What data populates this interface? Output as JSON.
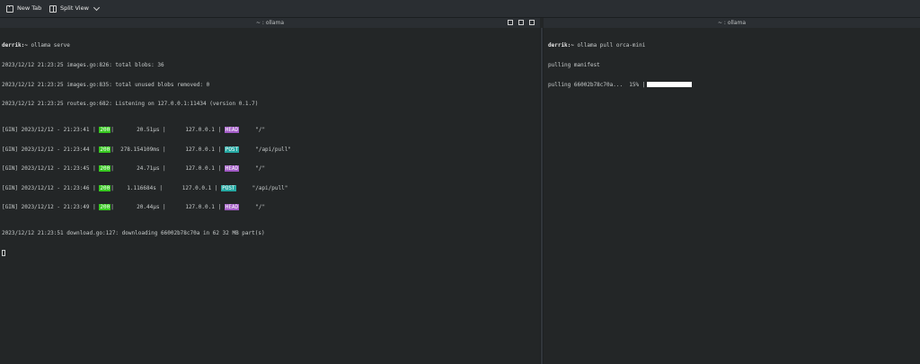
{
  "toolbar": {
    "new_tab_label": "New Tab",
    "split_view_label": "Split View"
  },
  "panes": [
    {
      "title": "~ : ollama",
      "prompt": "derrik:~",
      "command": " ollama serve",
      "log_lines": [
        "2023/12/12 21:23:25 images.go:826: total blobs: 36",
        "2023/12/12 21:23:25 images.go:835: total unused blobs removed: 0",
        "2023/12/12 21:23:25 routes.go:682: Listening on 127.0.0.1:11434 (version 0.1.7)"
      ],
      "gin_rows": [
        {
          "prefix": "[GIN] 2023/12/12 - 21:23:41 |",
          "status": "200",
          "latency": "       20.51µs |",
          "ip": "      127.0.0.1 |",
          "method": "HEAD",
          "path": "     \"/\""
        },
        {
          "prefix": "[GIN] 2023/12/12 - 21:23:44 |",
          "status": "200",
          "latency": "  278.154109ms |",
          "ip": "      127.0.0.1 |",
          "method": "POST",
          "path": "     \"/api/pull\""
        },
        {
          "prefix": "[GIN] 2023/12/12 - 21:23:45 |",
          "status": "200",
          "latency": "       24.71µs |",
          "ip": "      127.0.0.1 |",
          "method": "HEAD",
          "path": "     \"/\""
        },
        {
          "prefix": "[GIN] 2023/12/12 - 21:23:46 |",
          "status": "200",
          "latency": "    1.116684s |",
          "ip": "      127.0.0.1 |",
          "method": "POST",
          "path": "     \"/api/pull\""
        },
        {
          "prefix": "[GIN] 2023/12/12 - 21:23:49 |",
          "status": "200",
          "latency": "       20.44µs |",
          "ip": "      127.0.0.1 |",
          "method": "HEAD",
          "path": "     \"/\""
        }
      ],
      "download_line": "2023/12/12 21:23:51 download.go:127: downloading 66002b78c70a in 62 32 MB part(s)"
    },
    {
      "title": "~ : ollama",
      "prompt": "derrik:~",
      "command": " ollama pull orca-mini",
      "lines": [
        "pulling manifest"
      ],
      "progress_text": "pulling 66002b78c70a...  15% |",
      "progress_percent": 15
    }
  ]
}
